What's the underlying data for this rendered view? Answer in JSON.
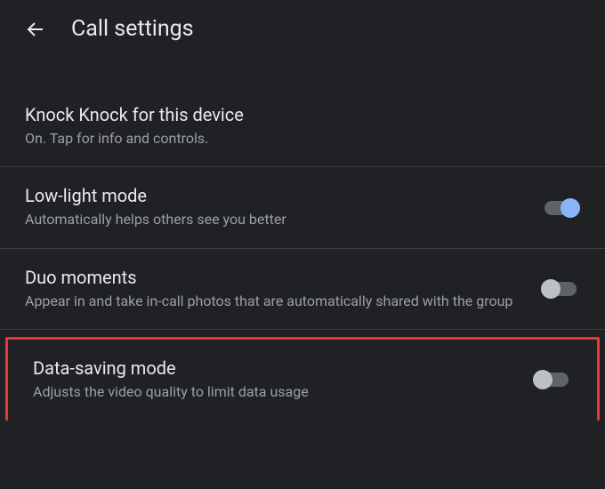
{
  "header": {
    "title": "Call settings"
  },
  "settings": {
    "knockKnock": {
      "title": "Knock Knock for this device",
      "subtitle": "On. Tap for info and controls."
    },
    "lowLight": {
      "title": "Low-light mode",
      "subtitle": "Automatically helps others see you better"
    },
    "duoMoments": {
      "title": "Duo moments",
      "subtitle": "Appear in and take in-call photos that are automatically shared with the group"
    },
    "dataSaving": {
      "title": "Data-saving mode",
      "subtitle": "Adjusts the video quality to limit data usage"
    }
  }
}
